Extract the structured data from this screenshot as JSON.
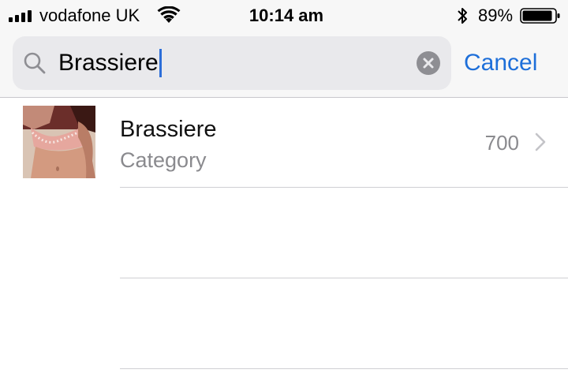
{
  "status_bar": {
    "carrier": "vodafone UK",
    "time": "10:14 am",
    "battery_percent": "89%",
    "icons": [
      "signal-icon",
      "wifi-icon",
      "bluetooth-icon",
      "battery-icon"
    ]
  },
  "search": {
    "query": "Brassiere",
    "cancel_label": "Cancel",
    "accent_color": "#1e6fd9"
  },
  "results": [
    {
      "title": "Brassiere",
      "subtitle": "Category",
      "count": "700"
    }
  ]
}
